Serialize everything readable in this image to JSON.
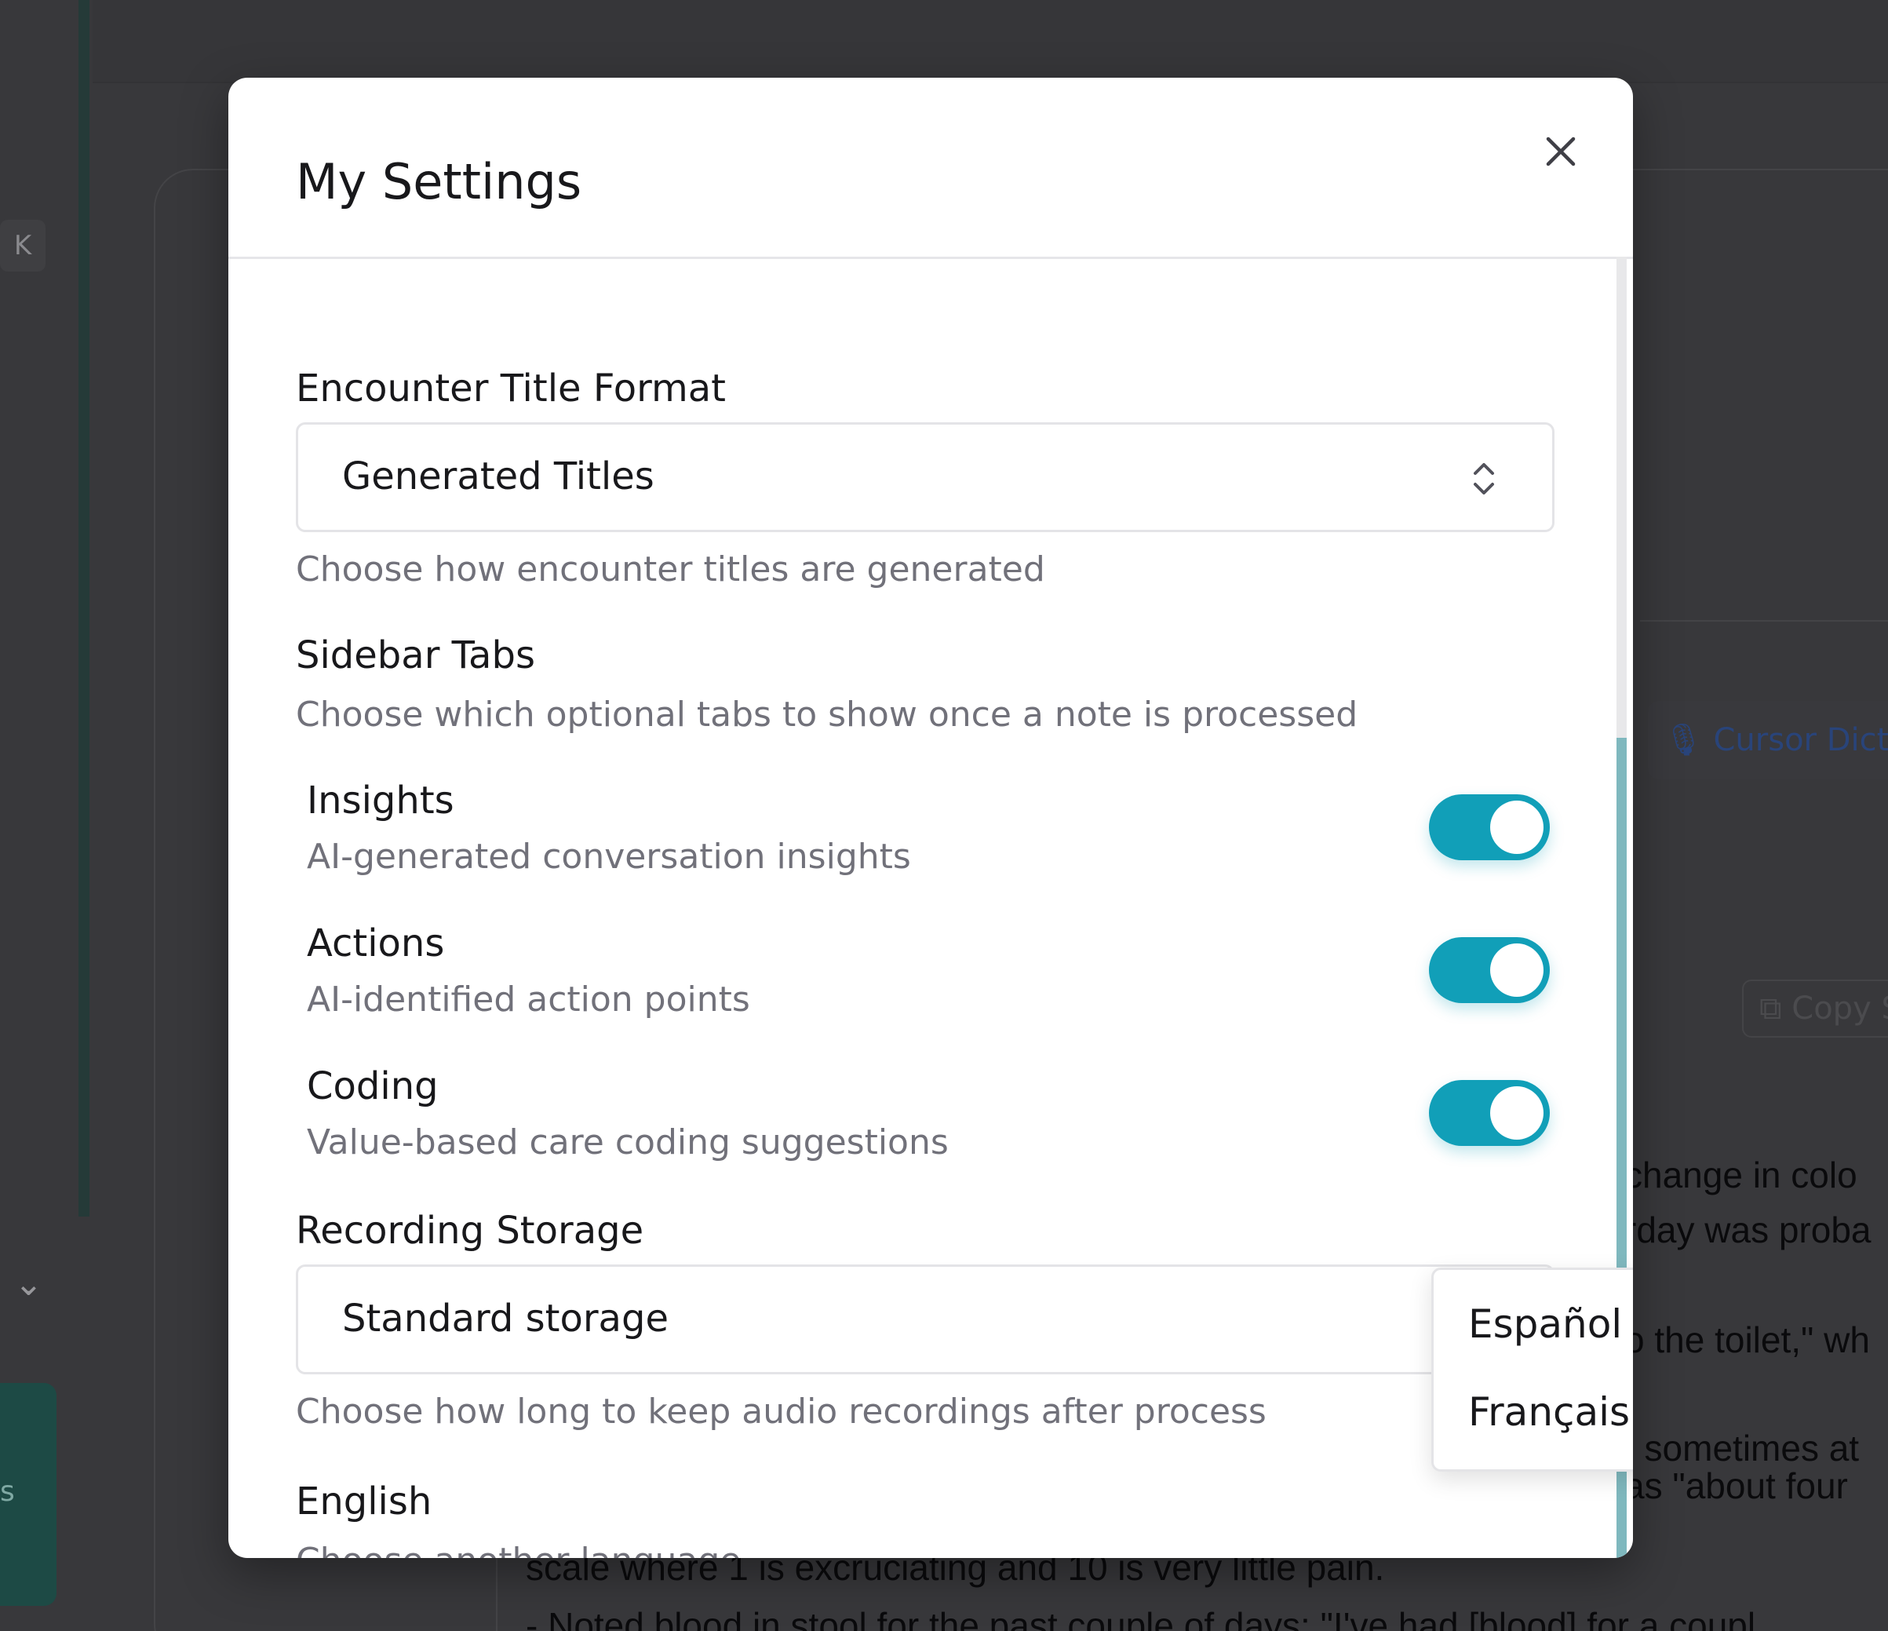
{
  "background": {
    "kbd_hint": "K",
    "cursor_dictation_label": "Cursor Dicta",
    "copy_label": "Copy S",
    "note_fragments": [
      "change in colo",
      "rday was proba",
      "o the toilet,\" wh",
      ", sometimes at",
      " as \"about four"
    ],
    "note_bottom_lines": [
      "scale where 1 is excruciating and 10 is very little pain.",
      "- Noted blood in stool for the past couple of days: \"I've had [blood] for a coupl"
    ]
  },
  "modal": {
    "title": "My Settings",
    "encounter_title_format": {
      "label": "Encounter Title Format",
      "selected": "Generated Titles",
      "help": "Choose how encounter titles are generated"
    },
    "sidebar_tabs": {
      "label": "Sidebar Tabs",
      "help": "Choose which optional tabs to show once a note is processed",
      "items": [
        {
          "label": "Insights",
          "description": "AI-generated conversation insights",
          "enabled": true
        },
        {
          "label": "Actions",
          "description": "AI-identified action points",
          "enabled": true
        },
        {
          "label": "Coding",
          "description": "Value-based care coding suggestions",
          "enabled": true
        }
      ]
    },
    "recording_storage": {
      "label": "Recording Storage",
      "selected": "Standard storage",
      "help": "Choose how long to keep audio recordings after process"
    },
    "language": {
      "current": "English",
      "help": "Choose another language",
      "options": [
        "Español",
        "Français"
      ]
    }
  },
  "colors": {
    "accent": "#119fb8",
    "overlay": "#38383b",
    "scroll_thumb": "#7fb8be"
  }
}
